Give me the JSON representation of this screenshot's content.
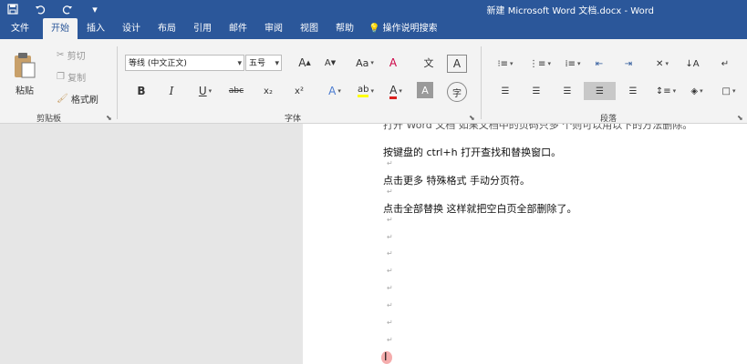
{
  "window": {
    "title": "新建 Microsoft Word 文档.docx - Word"
  },
  "qat": {
    "save_icon": "save-icon",
    "undo_icon": "undo-icon",
    "redo_icon": "redo-icon",
    "customize_icon": "chevron-down-icon"
  },
  "tabs": [
    {
      "label": "文件"
    },
    {
      "label": "开始"
    },
    {
      "label": "插入"
    },
    {
      "label": "设计"
    },
    {
      "label": "布局"
    },
    {
      "label": "引用"
    },
    {
      "label": "邮件"
    },
    {
      "label": "审阅"
    },
    {
      "label": "视图"
    },
    {
      "label": "帮助"
    }
  ],
  "tell_me": {
    "label": "操作说明搜索"
  },
  "clipboard": {
    "paste": "粘贴",
    "cut": "剪切",
    "copy": "复制",
    "format_painter": "格式刷",
    "group": "剪贴板"
  },
  "font": {
    "name": "等线 (中文正文)",
    "size": "五号",
    "group": "字体",
    "grow": "A",
    "shrink": "A",
    "case": "Aa",
    "clear": "A",
    "wen": "文",
    "border": "A",
    "bold": "B",
    "italic": "I",
    "underline": "U",
    "strike": "abc",
    "sub": "x₂",
    "sup": "x²",
    "effects": "A",
    "highlight": "ab",
    "color": "A",
    "shading": "A",
    "enclose": "字"
  },
  "paragraph": {
    "group": "段落"
  },
  "document": {
    "lines": [
      "打开 Word 文档 如果文档中的页码只多 个则可以用以下的方法删除。",
      "按键盘的 ctrl+h 打开查找和替换窗口。",
      "点击更多 特殊格式 手动分页符。",
      "点击全部替换 这样就把空白页全部删除了。"
    ],
    "paragraph_mark": "↵"
  },
  "colors": {
    "brand": "#2b579a",
    "ribbon": "#f3f3f3",
    "highlight": "#ffff00",
    "font_color": "#d9211e"
  }
}
